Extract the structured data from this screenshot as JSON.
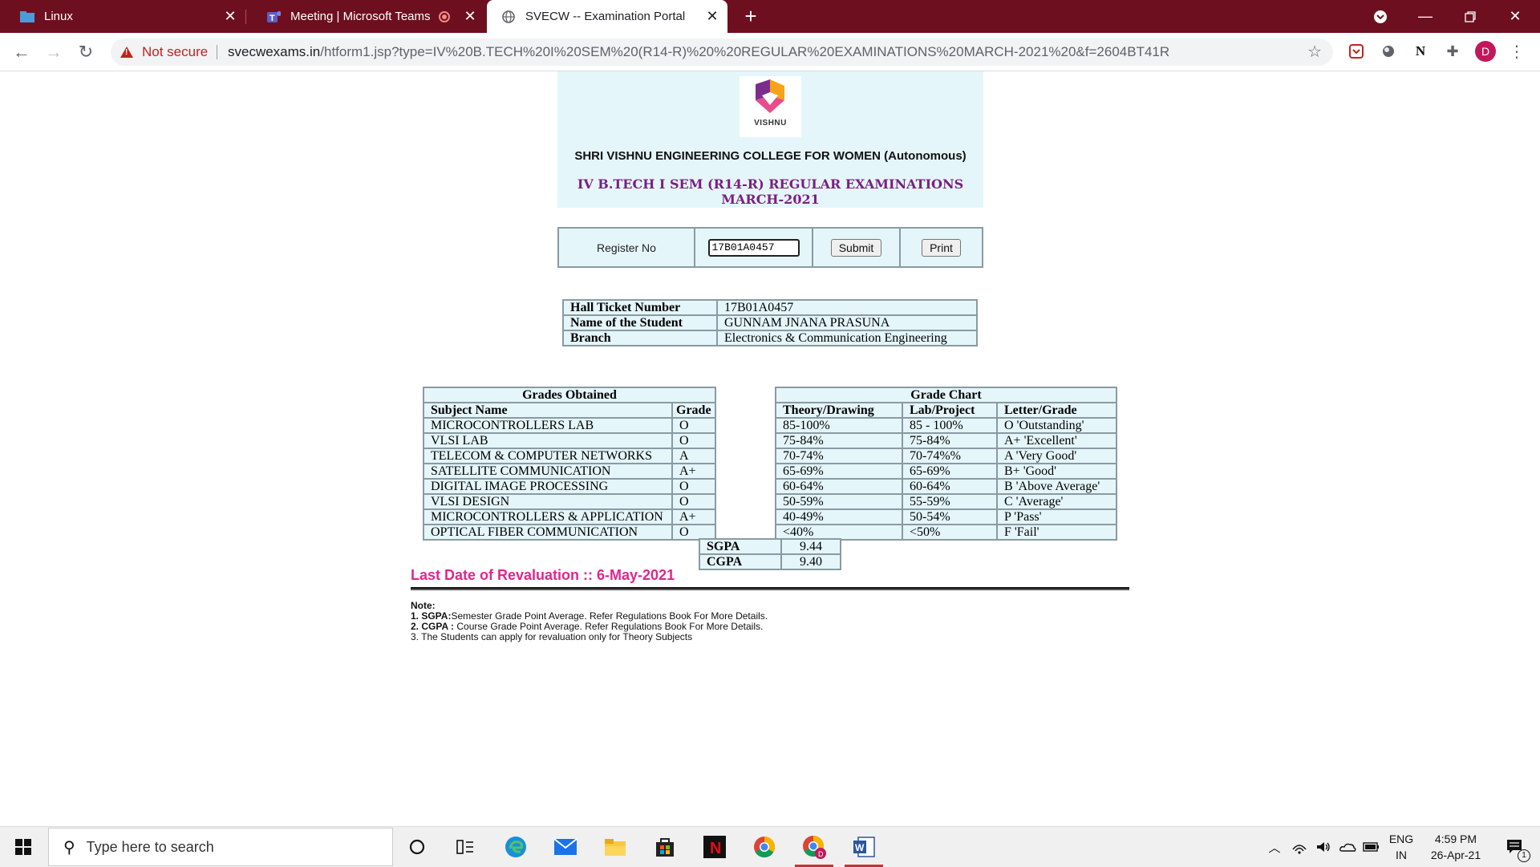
{
  "browser": {
    "tabs": [
      {
        "title": "Linux",
        "icon": "linux-folder-icon"
      },
      {
        "title": "Meeting | Microsoft Teams",
        "icon": "teams-icon",
        "recording": true
      },
      {
        "title": "SVECW -- Examination Portal",
        "icon": "globe-icon",
        "active": true
      }
    ],
    "new_tab": "+",
    "security_label": "Not secure",
    "url_host": "svecwexams.in",
    "url_path": "/htform1.jsp?type=IV%20B.TECH%20I%20SEM%20(R14-R)%20%20REGULAR%20EXAMINATIONS%20MARCH-2021%20&f=2604BT41R",
    "extensions": [
      "N",
      "D"
    ]
  },
  "page": {
    "logo_text": "VISHNU",
    "college": "SHRI VISHNU ENGINEERING COLLEGE FOR WOMEN (Autonomous)",
    "exam": "IV B.TECH I SEM (R14-R) REGULAR EXAMINATIONS MARCH-2021",
    "register_label": "Register No",
    "register_value": "17B01A0457",
    "submit_label": "Submit",
    "print_label": "Print",
    "student": {
      "ht_label": "Hall Ticket Number",
      "ht_value": "17B01A0457",
      "name_label": "Name of the Student",
      "name_value": "GUNNAM JNANA PRASUNA",
      "branch_label": "Branch",
      "branch_value": "Electronics & Communication Engineering"
    },
    "grades": {
      "title": "Grades Obtained",
      "col_subject": "Subject Name",
      "col_grade": "Grade",
      "rows": [
        {
          "subject": "MICROCONTROLLERS LAB",
          "grade": "O"
        },
        {
          "subject": "VLSI LAB",
          "grade": "O"
        },
        {
          "subject": "TELECOM & COMPUTER NETWORKS",
          "grade": "A"
        },
        {
          "subject": "SATELLITE COMMUNICATION",
          "grade": "A+"
        },
        {
          "subject": "DIGITAL IMAGE PROCESSING",
          "grade": "O"
        },
        {
          "subject": "VLSI DESIGN",
          "grade": "O"
        },
        {
          "subject": "MICROCONTROLLERS & APPLICATION",
          "grade": "A+"
        },
        {
          "subject": "OPTICAL FIBER COMMUNICATION",
          "grade": "O"
        }
      ]
    },
    "grade_chart": {
      "title": "Grade Chart",
      "col_theory": "Theory/Drawing",
      "col_lab": "Lab/Project",
      "col_letter": "Letter/Grade",
      "rows": [
        {
          "theory": "85-100%",
          "lab": "85 - 100%",
          "letter": "O 'Outstanding'"
        },
        {
          "theory": "75-84%",
          "lab": "75-84%",
          "letter": "A+ 'Excellent'"
        },
        {
          "theory": "70-74%",
          "lab": "70-74%%",
          "letter": "A 'Very Good'"
        },
        {
          "theory": "65-69%",
          "lab": "65-69%",
          "letter": "B+ 'Good'"
        },
        {
          "theory": "60-64%",
          "lab": "60-64%",
          "letter": "B 'Above Average'"
        },
        {
          "theory": "50-59%",
          "lab": "55-59%",
          "letter": "C 'Average'"
        },
        {
          "theory": "40-49%",
          "lab": "50-54%",
          "letter": "P 'Pass'"
        },
        {
          "theory": "<40%",
          "lab": "<50%",
          "letter": "F 'Fail'"
        }
      ]
    },
    "sgpa_label": "SGPA",
    "sgpa_value": "9.44",
    "cgpa_label": "CGPA",
    "cgpa_value": "9.40",
    "revaluation": "Last Date of Revaluation :: 6-May-2021",
    "note_title": "Note:",
    "notes": [
      {
        "bold": "1. SGPA:",
        "text": "Semester Grade Point Average. Refer Regulations Book For More Details."
      },
      {
        "bold": "2. CGPA :",
        "text": " Course Grade Point Average. Refer Regulations Book For More Details."
      },
      {
        "bold": "",
        "text": "3. The Students can apply for revaluation only for Theory Subjects"
      }
    ]
  },
  "taskbar": {
    "search_placeholder": "Type here to search",
    "lang_top": "ENG",
    "lang_bottom": "IN",
    "time": "4:59 PM",
    "date": "26-Apr-21",
    "notification_count": "1"
  },
  "colors": {
    "tabstrip": "#6e0f1f",
    "header_bg": "#e5f6fa",
    "exam_title": "#7a1f82",
    "revaluation": "#e0268c"
  }
}
